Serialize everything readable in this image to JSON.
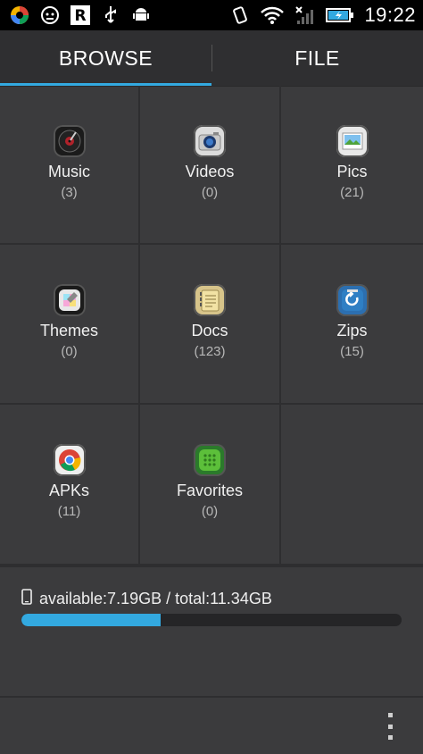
{
  "status_bar": {
    "time": "19:22",
    "left_icons": [
      "app-color-icon",
      "face-icon",
      "r-app-icon",
      "usb-icon",
      "android-debug-icon"
    ],
    "right_icons": [
      "vibrate-icon",
      "wifi-icon",
      "no-signal-icon",
      "battery-charging-icon"
    ]
  },
  "tabs": [
    {
      "label": "BROWSE",
      "active": true
    },
    {
      "label": "FILE",
      "active": false
    }
  ],
  "categories": [
    {
      "label": "Music",
      "count": "(3)",
      "icon": "music-icon"
    },
    {
      "label": "Videos",
      "count": "(0)",
      "icon": "camera-icon"
    },
    {
      "label": "Pics",
      "count": "(21)",
      "icon": "picture-icon"
    },
    {
      "label": "Themes",
      "count": "(0)",
      "icon": "themes-icon"
    },
    {
      "label": "Docs",
      "count": "(123)",
      "icon": "docs-icon"
    },
    {
      "label": "Zips",
      "count": "(15)",
      "icon": "zip-icon"
    },
    {
      "label": "APKs",
      "count": "(11)",
      "icon": "chrome-icon"
    },
    {
      "label": "Favorites",
      "count": "(0)",
      "icon": "favorites-icon"
    }
  ],
  "storage": {
    "text": "available:7.19GB / total:11.34GB",
    "used_fraction": 0.366,
    "icon": "phone-storage-icon"
  },
  "colors": {
    "accent": "#33a9e0",
    "background": "#3b3b3d"
  }
}
